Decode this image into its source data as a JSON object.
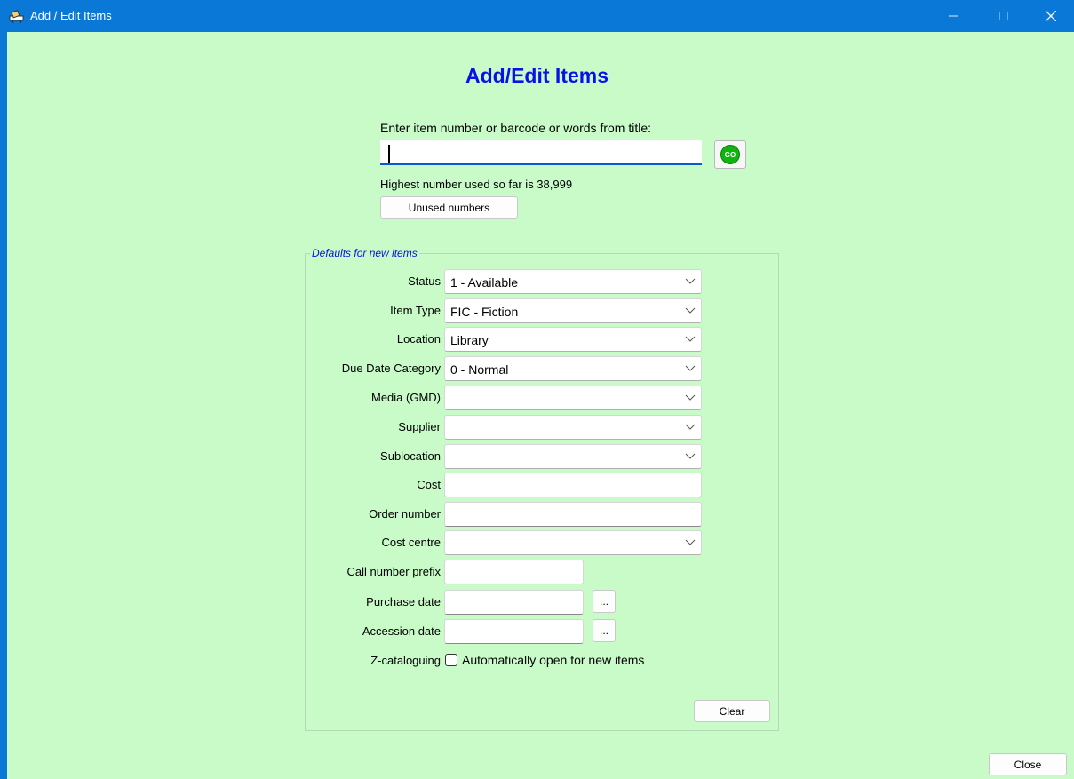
{
  "window": {
    "title": "Add / Edit Items",
    "icons": {
      "app": "book-cart-icon",
      "minimize": "minimize-icon",
      "maximize": "maximize-icon",
      "close": "close-icon"
    }
  },
  "heading": "Add/Edit Items",
  "search": {
    "prompt": "Enter item number or barcode or words from title:",
    "value": "",
    "go_label": "GO"
  },
  "highest_text": "Highest number used so far is 38,999",
  "unused_label": "Unused numbers",
  "defaults": {
    "legend": "Defaults for new items",
    "status": {
      "label": "Status",
      "value": "1 - Available"
    },
    "item_type": {
      "label": "Item Type",
      "value": "FIC - Fiction"
    },
    "location": {
      "label": "Location",
      "value": "Library"
    },
    "due_date_category": {
      "label": "Due Date Category",
      "value": "0 - Normal"
    },
    "media": {
      "label": "Media (GMD)",
      "value": ""
    },
    "supplier": {
      "label": "Supplier",
      "value": ""
    },
    "sublocation": {
      "label": "Sublocation",
      "value": ""
    },
    "cost": {
      "label": "Cost",
      "value": ""
    },
    "order_number": {
      "label": "Order number",
      "value": ""
    },
    "cost_centre": {
      "label": "Cost centre",
      "value": ""
    },
    "call_number_prefix": {
      "label": "Call number prefix",
      "value": ""
    },
    "purchase_date": {
      "label": "Purchase date",
      "value": "",
      "button": "..."
    },
    "accession_date": {
      "label": "Accession date",
      "value": "",
      "button": "..."
    },
    "z_cataloguing": {
      "label": "Z-cataloguing",
      "checkbox_label": "Automatically open for new items",
      "checked": false
    },
    "clear_label": "Clear"
  },
  "close_label": "Close",
  "colors": {
    "titlebar": "#0a78d7",
    "background": "#c8fbc8",
    "heading": "#0a10e6",
    "go": "#11b311"
  }
}
